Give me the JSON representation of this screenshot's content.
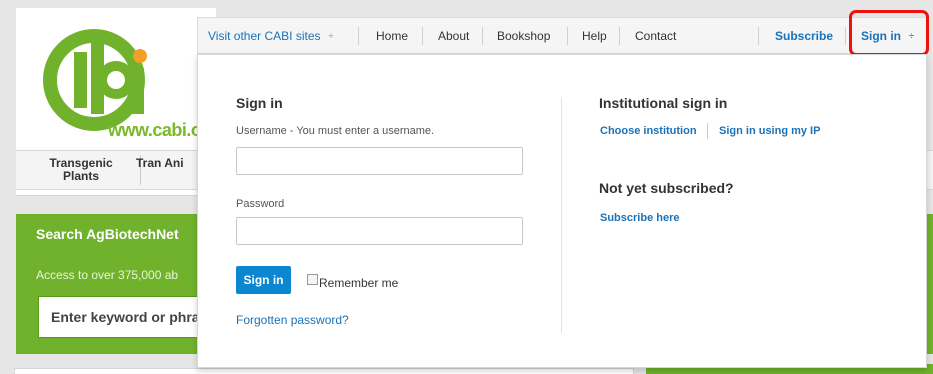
{
  "background": {
    "logo_url_text": "www.cabi.org",
    "nav": [
      "Transgenic Plants",
      "Tran Ani"
    ],
    "search_title": "Search AgBiotechNet",
    "search_subtitle": "Access to over 375,000 ab",
    "search_placeholder": "Enter keyword or phra"
  },
  "topbar": {
    "visit_label": "Visit other CABI sites",
    "home": "Home",
    "about": "About",
    "bookshop": "Bookshop",
    "help": "Help",
    "contact": "Contact",
    "subscribe": "Subscribe",
    "signin": "Sign in",
    "updown_glyph": "÷"
  },
  "signin_form": {
    "heading": "Sign in",
    "username_label": "Username - You must enter a username.",
    "username_value": "",
    "password_label": "Password",
    "password_value": "",
    "button": "Sign in",
    "remember": "Remember me",
    "forgot": "Forgotten password?"
  },
  "institutional": {
    "heading": "Institutional sign in",
    "choose": "Choose institution",
    "ip": "Sign in using my IP",
    "not_subscribed": "Not yet subscribed?",
    "subscribe_here": "Subscribe here"
  },
  "colors": {
    "brand_green": "#71b22c",
    "link_blue": "#1a72b8",
    "button_blue": "#0b86d1",
    "highlight_red": "#ee1111"
  }
}
